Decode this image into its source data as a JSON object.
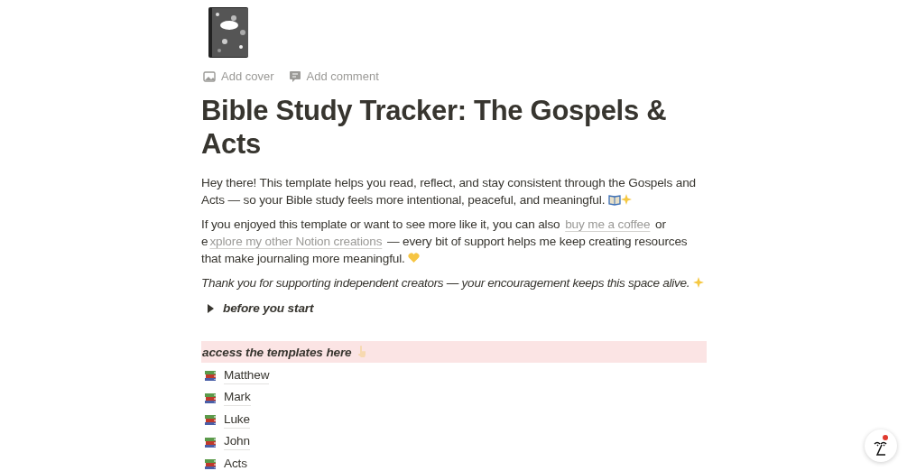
{
  "page_actions": [
    "Add cover",
    "Add comment"
  ],
  "title": "Bible Study Tracker: The Gospels & Acts",
  "intro": "Hey there! This template helps you read, reflect, and stay consistent through the  Gospels and Acts — so your Bible study feels more intentional, peaceful, and meaningful.",
  "support": [
    {
      "kind": "text",
      "text": "If you enjoyed this template or want to see more like it, you can also "
    },
    {
      "kind": "link",
      "text": "buy me a coffee"
    },
    {
      "kind": "text",
      "text": " or e"
    },
    {
      "kind": "link",
      "text": "xplore my other Notion creations"
    },
    {
      "kind": "text",
      "text": " — every bit of support helps me keep creating resources that make journaling more meaningful."
    }
  ],
  "thanks": "Thank you for supporting independent creators — your encouragement keeps this space alive.",
  "toggle": {
    "label": "before you start",
    "expanded": false
  },
  "callout": "access the templates here",
  "templates": [
    "Matthew",
    "Mark",
    "Luke",
    "John",
    "Acts"
  ]
}
